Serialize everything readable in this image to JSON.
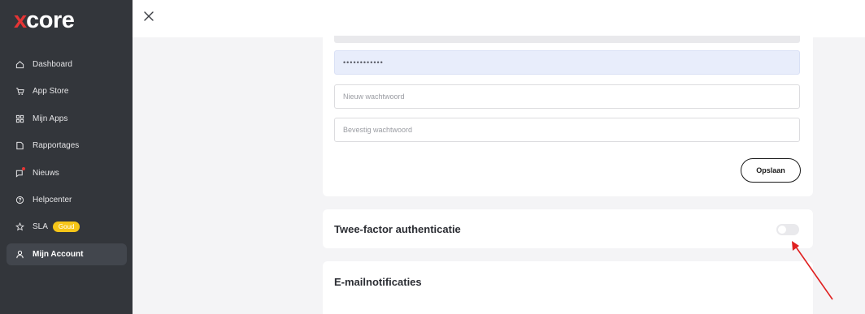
{
  "logo": {
    "x": "x",
    "rest": "core"
  },
  "sidebar": {
    "items": [
      {
        "label": "Dashboard",
        "icon": "home-icon"
      },
      {
        "label": "App Store",
        "icon": "cart-icon"
      },
      {
        "label": "Mijn Apps",
        "icon": "grid-icon"
      },
      {
        "label": "Rapportages",
        "icon": "document-icon"
      },
      {
        "label": "Nieuws",
        "icon": "chat-notification-icon"
      },
      {
        "label": "Helpcenter",
        "icon": "help-icon"
      },
      {
        "label": "SLA",
        "icon": "star-icon",
        "badge": "Goud"
      },
      {
        "label": "Mijn Account",
        "icon": "user-icon",
        "active": true
      }
    ]
  },
  "password": {
    "current_value": "••••••••••••",
    "new_placeholder": "Nieuw wachtwoord",
    "confirm_placeholder": "Bevestig wachtwoord",
    "save_label": "Opslaan"
  },
  "two_factor": {
    "title": "Twee-factor authenticatie",
    "enabled": false
  },
  "email_notifications": {
    "title": "E-mailnotificaties"
  },
  "colors": {
    "brand_red": "#e63535",
    "sidebar_bg": "#33363b",
    "badge_gold": "#f5c518",
    "arrow": "#e02020"
  }
}
